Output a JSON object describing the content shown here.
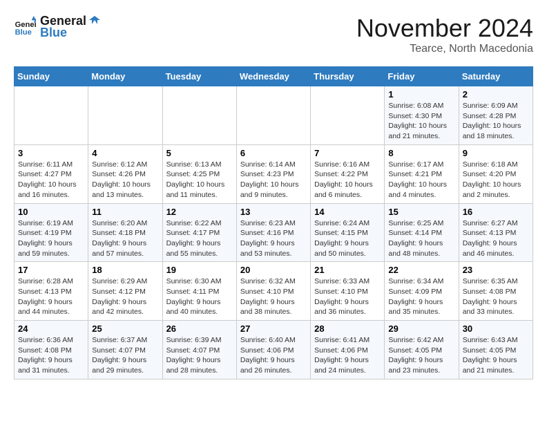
{
  "header": {
    "logo_line1": "General",
    "logo_line2": "Blue",
    "month": "November 2024",
    "location": "Tearce, North Macedonia"
  },
  "weekdays": [
    "Sunday",
    "Monday",
    "Tuesday",
    "Wednesday",
    "Thursday",
    "Friday",
    "Saturday"
  ],
  "weeks": [
    [
      {
        "day": "",
        "info": ""
      },
      {
        "day": "",
        "info": ""
      },
      {
        "day": "",
        "info": ""
      },
      {
        "day": "",
        "info": ""
      },
      {
        "day": "",
        "info": ""
      },
      {
        "day": "1",
        "info": "Sunrise: 6:08 AM\nSunset: 4:30 PM\nDaylight: 10 hours\nand 21 minutes."
      },
      {
        "day": "2",
        "info": "Sunrise: 6:09 AM\nSunset: 4:28 PM\nDaylight: 10 hours\nand 18 minutes."
      }
    ],
    [
      {
        "day": "3",
        "info": "Sunrise: 6:11 AM\nSunset: 4:27 PM\nDaylight: 10 hours\nand 16 minutes."
      },
      {
        "day": "4",
        "info": "Sunrise: 6:12 AM\nSunset: 4:26 PM\nDaylight: 10 hours\nand 13 minutes."
      },
      {
        "day": "5",
        "info": "Sunrise: 6:13 AM\nSunset: 4:25 PM\nDaylight: 10 hours\nand 11 minutes."
      },
      {
        "day": "6",
        "info": "Sunrise: 6:14 AM\nSunset: 4:23 PM\nDaylight: 10 hours\nand 9 minutes."
      },
      {
        "day": "7",
        "info": "Sunrise: 6:16 AM\nSunset: 4:22 PM\nDaylight: 10 hours\nand 6 minutes."
      },
      {
        "day": "8",
        "info": "Sunrise: 6:17 AM\nSunset: 4:21 PM\nDaylight: 10 hours\nand 4 minutes."
      },
      {
        "day": "9",
        "info": "Sunrise: 6:18 AM\nSunset: 4:20 PM\nDaylight: 10 hours\nand 2 minutes."
      }
    ],
    [
      {
        "day": "10",
        "info": "Sunrise: 6:19 AM\nSunset: 4:19 PM\nDaylight: 9 hours\nand 59 minutes."
      },
      {
        "day": "11",
        "info": "Sunrise: 6:20 AM\nSunset: 4:18 PM\nDaylight: 9 hours\nand 57 minutes."
      },
      {
        "day": "12",
        "info": "Sunrise: 6:22 AM\nSunset: 4:17 PM\nDaylight: 9 hours\nand 55 minutes."
      },
      {
        "day": "13",
        "info": "Sunrise: 6:23 AM\nSunset: 4:16 PM\nDaylight: 9 hours\nand 53 minutes."
      },
      {
        "day": "14",
        "info": "Sunrise: 6:24 AM\nSunset: 4:15 PM\nDaylight: 9 hours\nand 50 minutes."
      },
      {
        "day": "15",
        "info": "Sunrise: 6:25 AM\nSunset: 4:14 PM\nDaylight: 9 hours\nand 48 minutes."
      },
      {
        "day": "16",
        "info": "Sunrise: 6:27 AM\nSunset: 4:13 PM\nDaylight: 9 hours\nand 46 minutes."
      }
    ],
    [
      {
        "day": "17",
        "info": "Sunrise: 6:28 AM\nSunset: 4:13 PM\nDaylight: 9 hours\nand 44 minutes."
      },
      {
        "day": "18",
        "info": "Sunrise: 6:29 AM\nSunset: 4:12 PM\nDaylight: 9 hours\nand 42 minutes."
      },
      {
        "day": "19",
        "info": "Sunrise: 6:30 AM\nSunset: 4:11 PM\nDaylight: 9 hours\nand 40 minutes."
      },
      {
        "day": "20",
        "info": "Sunrise: 6:32 AM\nSunset: 4:10 PM\nDaylight: 9 hours\nand 38 minutes."
      },
      {
        "day": "21",
        "info": "Sunrise: 6:33 AM\nSunset: 4:10 PM\nDaylight: 9 hours\nand 36 minutes."
      },
      {
        "day": "22",
        "info": "Sunrise: 6:34 AM\nSunset: 4:09 PM\nDaylight: 9 hours\nand 35 minutes."
      },
      {
        "day": "23",
        "info": "Sunrise: 6:35 AM\nSunset: 4:08 PM\nDaylight: 9 hours\nand 33 minutes."
      }
    ],
    [
      {
        "day": "24",
        "info": "Sunrise: 6:36 AM\nSunset: 4:08 PM\nDaylight: 9 hours\nand 31 minutes."
      },
      {
        "day": "25",
        "info": "Sunrise: 6:37 AM\nSunset: 4:07 PM\nDaylight: 9 hours\nand 29 minutes."
      },
      {
        "day": "26",
        "info": "Sunrise: 6:39 AM\nSunset: 4:07 PM\nDaylight: 9 hours\nand 28 minutes."
      },
      {
        "day": "27",
        "info": "Sunrise: 6:40 AM\nSunset: 4:06 PM\nDaylight: 9 hours\nand 26 minutes."
      },
      {
        "day": "28",
        "info": "Sunrise: 6:41 AM\nSunset: 4:06 PM\nDaylight: 9 hours\nand 24 minutes."
      },
      {
        "day": "29",
        "info": "Sunrise: 6:42 AM\nSunset: 4:05 PM\nDaylight: 9 hours\nand 23 minutes."
      },
      {
        "day": "30",
        "info": "Sunrise: 6:43 AM\nSunset: 4:05 PM\nDaylight: 9 hours\nand 21 minutes."
      }
    ]
  ]
}
